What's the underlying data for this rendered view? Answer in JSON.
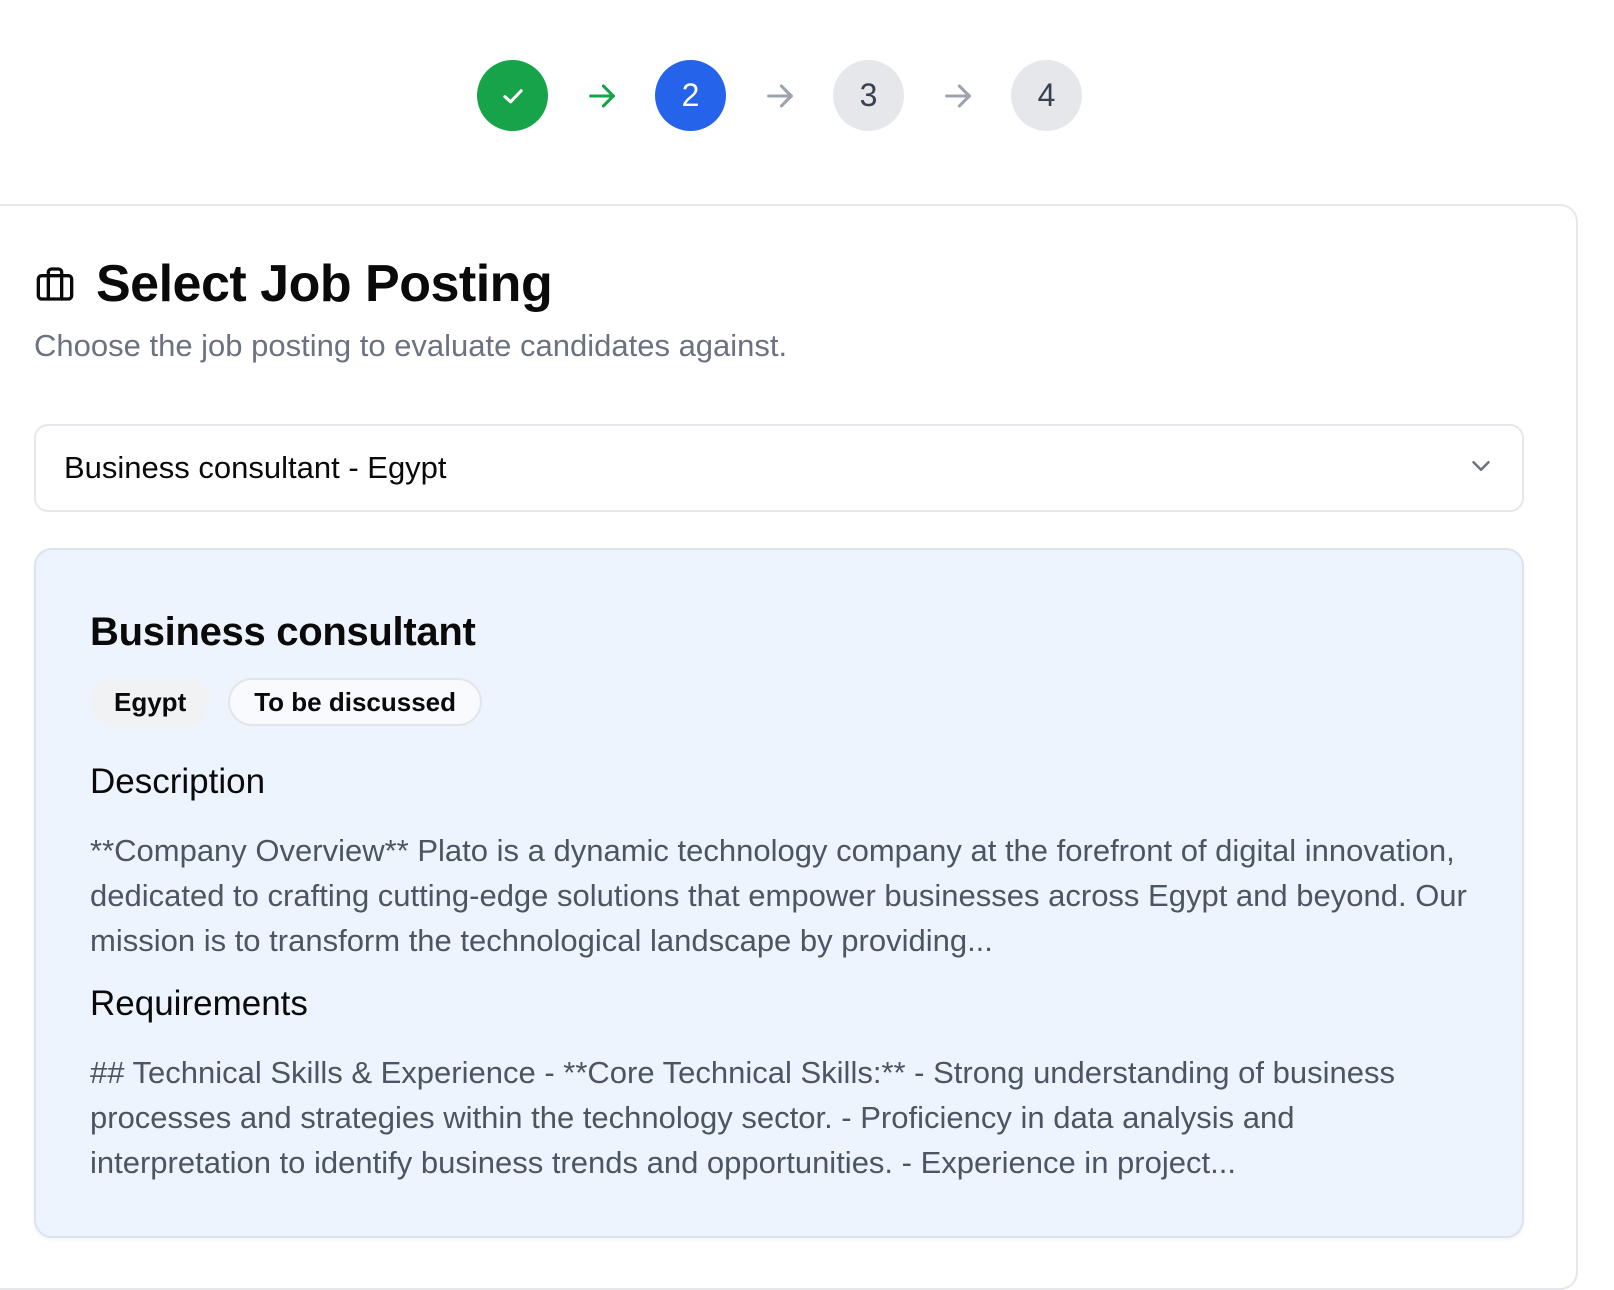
{
  "stepper": {
    "steps": [
      {
        "label": "",
        "state": "done",
        "icon": "check-icon"
      },
      {
        "label": "2",
        "state": "active"
      },
      {
        "label": "3",
        "state": "pending"
      },
      {
        "label": "4",
        "state": "pending"
      }
    ],
    "colors": {
      "done": "#16a34a",
      "active": "#2563eb",
      "pending": "#e5e7eb"
    }
  },
  "card": {
    "icon": "briefcase-icon",
    "title": "Select Job Posting",
    "subtitle": "Choose the job posting to evaluate candidates against."
  },
  "select": {
    "value": "Business consultant - Egypt",
    "icon": "chevron-down-icon"
  },
  "details": {
    "title": "Business consultant",
    "badges": [
      "Egypt",
      "To be discussed"
    ],
    "description_heading": "Description",
    "description_text": "**Company Overview** Plato is a dynamic technology company at the forefront of digital innovation, dedicated to crafting cutting-edge solutions that empower businesses across Egypt and beyond. Our mission is to transform the technological landscape by providing...",
    "requirements_heading": "Requirements",
    "requirements_text": "## Technical Skills & Experience - **Core Technical Skills:** - Strong understanding of business processes and strategies within the technology sector. - Proficiency in data analysis and interpretation to identify business trends and opportunities. - Experience in project..."
  }
}
